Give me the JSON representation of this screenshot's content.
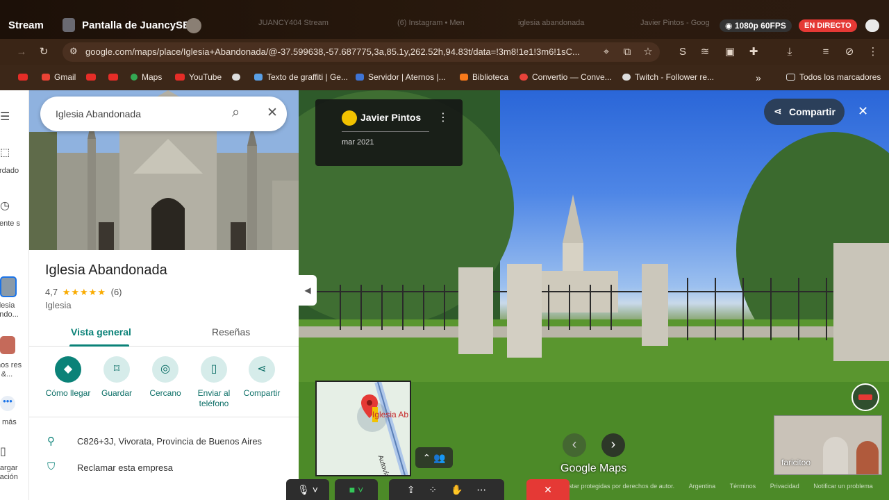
{
  "stream": {
    "title": "Stream",
    "screen_title": "Pantalla de JuancySB",
    "ghost_tabs": [
      "JUANCY404 Stream",
      "(6) Instagram • Men",
      "iglesia abandonada",
      "Javier Pintos - Goog"
    ],
    "quality": "1080p 60FPS",
    "live": "EN DIRECTO"
  },
  "browser": {
    "url": "google.com/maps/place/Iglesia+Abandonada/@-37.599638,-57.687775,3a,85.1y,262.52h,94.83t/data=!3m8!1e1!3m6!1sC..."
  },
  "bookmarks": {
    "items": [
      "Gmail",
      "Maps",
      "YouTube",
      "Texto de graffiti | Ge...",
      "Servidor | Aternos |...",
      "Biblioteca",
      "Convertio — Conve...",
      "Twitch - Follower re..."
    ],
    "all": "Todos los marcadores"
  },
  "rail": {
    "saved": "ardado",
    "recent": "ciente s",
    "current": "lesia ando...",
    "buenos": "enos res &...",
    "more": "r más",
    "download": "cargar cación"
  },
  "panel": {
    "search_value": "Iglesia Abandonada",
    "place_name": "Iglesia Abandonada",
    "rating": "4,7",
    "stars": "★★★★★",
    "review_count": "(6)",
    "category": "Iglesia",
    "tabs": [
      "Vista general",
      "Reseñas"
    ],
    "actions": [
      {
        "label": "Cómo llegar"
      },
      {
        "label": "Guardar"
      },
      {
        "label": "Cercano"
      },
      {
        "label": "Enviar al teléfono"
      },
      {
        "label": "Compartir"
      }
    ],
    "address": "C826+3J, Vivorata, Provincia de Buenos Aires",
    "claim": "Reclamar esta empresa"
  },
  "streetview": {
    "author": "Javier Pintos",
    "date": "mar 2021",
    "share": "Compartir",
    "mini_map_label": "Iglesia Ab",
    "road_label": "Autovía",
    "brand": "Google Maps",
    "webcam_name": "faricitoo",
    "footer": [
      "estar protegidas por derechos de autor.",
      "Argentina",
      "Términos",
      "Privacidad",
      "Notificar un problema"
    ]
  },
  "colors": {
    "accent": "#0b8278",
    "live_red": "#e53935",
    "star": "#f9ab00"
  }
}
